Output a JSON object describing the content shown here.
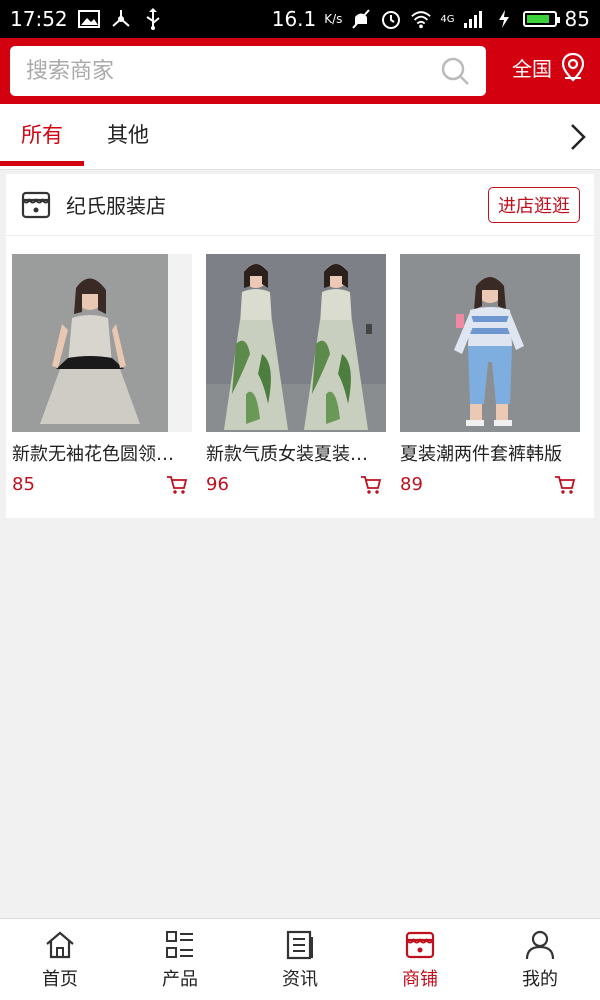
{
  "status_bar": {
    "time": "17:52",
    "speed": "16.1",
    "speed_unit": "K/s",
    "network": "4G",
    "battery": "85",
    "battery_level": 0.85
  },
  "search": {
    "placeholder": "搜索商家",
    "region_label": "全国"
  },
  "tabs": [
    {
      "label": "所有",
      "active": true
    },
    {
      "label": "其他",
      "active": false
    }
  ],
  "store": {
    "name": "纪氏服装店",
    "enter_label": "进店逛逛",
    "products": [
      {
        "title": "新款无袖花色圆领连衣裙",
        "price": "85",
        "image": "dress-with-black-bow"
      },
      {
        "title": "新款气质女装夏装长裙",
        "price": "96",
        "image": "floral-maxi-dress"
      },
      {
        "title": "夏装潮两件套裤韩版",
        "price": "89",
        "image": "striped-top-cropped-pants"
      }
    ]
  },
  "bottom_nav": [
    {
      "label": "首页",
      "icon": "home-icon",
      "active": false
    },
    {
      "label": "产品",
      "icon": "grid-list-icon",
      "active": false
    },
    {
      "label": "资讯",
      "icon": "document-icon",
      "active": false
    },
    {
      "label": "商铺",
      "icon": "store-icon",
      "active": true
    },
    {
      "label": "我的",
      "icon": "user-icon",
      "active": false
    }
  ],
  "colors": {
    "brand": "#d3000f",
    "accent_text": "#c0101e",
    "background": "#f1f1f1"
  }
}
